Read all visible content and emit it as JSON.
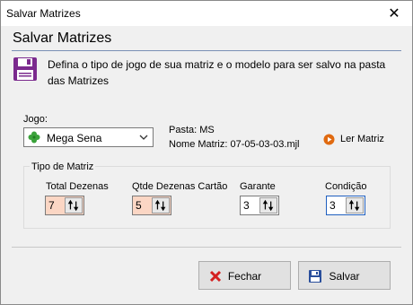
{
  "window": {
    "title": "Salvar Matrizes",
    "close_glyph": "✕"
  },
  "header": {
    "title": "Salvar Matrizes",
    "icon": "floppy-disk-icon",
    "description": "Defina o tipo de jogo de sua matriz e o modelo para ser salvo na pasta das Matrizes"
  },
  "jogo": {
    "label": "Jogo:",
    "selected": "Mega Sena",
    "icon": "clover-icon",
    "pasta": "Pasta: MS",
    "nome_matriz": "Nome Matriz: 07-05-03-03.mjl",
    "ler_matriz": "Ler Matriz"
  },
  "tipo_matriz": {
    "legend": "Tipo de Matriz",
    "total_dezenas": {
      "label": "Total Dezenas",
      "value": "7"
    },
    "qtde_dezenas": {
      "label": "Qtde Dezenas Cartão",
      "value": "5"
    },
    "garante": {
      "label": "Garante",
      "value": "3"
    },
    "condicao": {
      "label": "Condição",
      "value": "3"
    }
  },
  "buttons": {
    "fechar": "Fechar",
    "salvar": "Salvar"
  },
  "colors": {
    "peach": "#fbd6c4",
    "header_icon": "#7b2a8e",
    "close_x": "#d42020",
    "play": "#e06a10",
    "clover": "#3aa23a",
    "save_blue": "#2a4f9c"
  }
}
